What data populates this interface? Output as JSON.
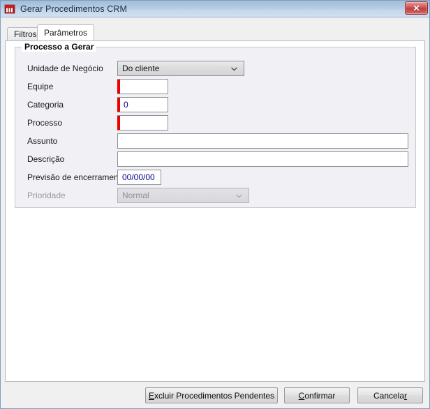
{
  "window": {
    "title": "Gerar Procedimentos CRM",
    "icon": "crm-app-icon",
    "close_label": "✕"
  },
  "tabs": [
    {
      "label": "Filtros",
      "active": false
    },
    {
      "label": "Parâmetros",
      "active": true
    }
  ],
  "groupbox": {
    "title": "Processo a Gerar"
  },
  "form": {
    "fields": [
      {
        "label": "Unidade de Negócio",
        "type": "combo",
        "value": "Do cliente",
        "disabled": false,
        "required": false
      },
      {
        "label": "Equipe",
        "type": "text",
        "value": "",
        "disabled": false,
        "required": true
      },
      {
        "label": "Categoria",
        "type": "text",
        "value": "0",
        "disabled": false,
        "required": true
      },
      {
        "label": "Processo",
        "type": "text",
        "value": "",
        "disabled": false,
        "required": true
      },
      {
        "label": "Assunto",
        "type": "text",
        "value": "",
        "disabled": false,
        "required": false
      },
      {
        "label": "Descrição",
        "type": "text",
        "value": "",
        "disabled": false,
        "required": false
      },
      {
        "label": "Previsão de encerramento",
        "type": "text",
        "value": "00/00/00",
        "disabled": false,
        "required": false
      },
      {
        "label": "Prioridade",
        "type": "combo",
        "value": "Normal",
        "disabled": true,
        "required": false
      }
    ]
  },
  "footer": {
    "buttons": [
      {
        "accel": "E",
        "rest": "xcluir Procedimentos Pendentes",
        "name": "excluir-procedimentos-pendentes-button"
      },
      {
        "accel": "C",
        "rest": "onfirmar",
        "name": "confirmar-button"
      },
      {
        "accel": "",
        "rest": "Cancela",
        "tail": "r",
        "name": "cancelar-button"
      }
    ]
  },
  "colors": {
    "required_marker": "#ee0000",
    "value_text": "#00008b",
    "titlebar_from": "#a3bdd8",
    "titlebar_to": "#cfe0f1",
    "close_button": "#c23f3f"
  }
}
